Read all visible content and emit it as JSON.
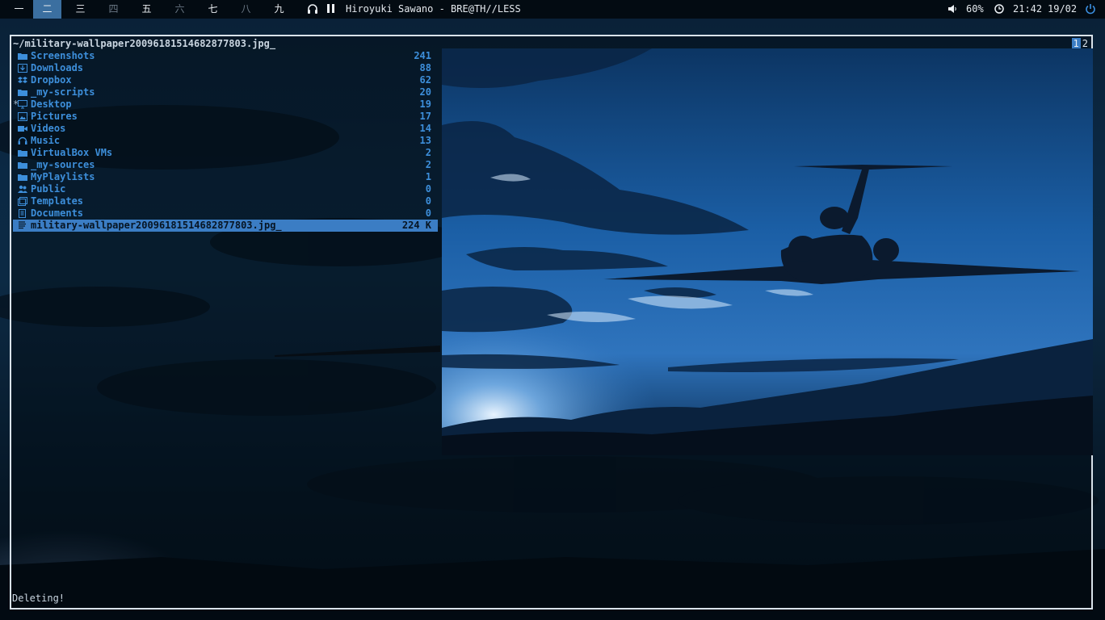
{
  "topbar": {
    "workspaces": [
      {
        "label": "一",
        "state": "normal"
      },
      {
        "label": "二",
        "state": "active"
      },
      {
        "label": "三",
        "state": "normal"
      },
      {
        "label": "四",
        "state": "empty"
      },
      {
        "label": "五",
        "state": "normal"
      },
      {
        "label": "六",
        "state": "empty"
      },
      {
        "label": "七",
        "state": "normal"
      },
      {
        "label": "八",
        "state": "empty"
      },
      {
        "label": "九",
        "state": "normal"
      }
    ],
    "media_icon": "headphones-icon",
    "playback_icon": "pause-icon",
    "now_playing": "Hiroyuki Sawano - BRE@TH//LESS",
    "volume_icon": "speaker-icon",
    "volume": "60%",
    "clock_icon": "clock-icon",
    "time": "21:42",
    "date": "19/02",
    "power_icon": "power-icon",
    "accent_color": "#3b6fa0"
  },
  "terminal": {
    "path": "~/military-wallpaper20096181514682877803.jpg_",
    "tabs": [
      "1",
      "2"
    ],
    "active_tab": "1",
    "entries": [
      {
        "icon": "folder-icon",
        "name": "Screenshots",
        "count": "241"
      },
      {
        "icon": "download-icon",
        "name": "Downloads",
        "count": "88"
      },
      {
        "icon": "dropbox-icon",
        "name": "Dropbox",
        "count": "62"
      },
      {
        "icon": "folder-icon",
        "name": "_my-scripts",
        "count": "20"
      },
      {
        "icon": "desktop-icon",
        "name": "Desktop",
        "count": "19",
        "mark": "*"
      },
      {
        "icon": "picture-icon",
        "name": "Pictures",
        "count": "17"
      },
      {
        "icon": "video-icon",
        "name": "Videos",
        "count": "14"
      },
      {
        "icon": "headphones-icon",
        "name": "Music",
        "count": "13"
      },
      {
        "icon": "folder-icon",
        "name": "VirtualBox VMs",
        "count": "2"
      },
      {
        "icon": "folder-icon",
        "name": "_my-sources",
        "count": "2"
      },
      {
        "icon": "folder-icon",
        "name": "MyPlaylists",
        "count": "1"
      },
      {
        "icon": "users-icon",
        "name": "Public",
        "count": "0"
      },
      {
        "icon": "template-icon",
        "name": "Templates",
        "count": "0"
      },
      {
        "icon": "document-icon",
        "name": "Documents",
        "count": "0"
      },
      {
        "icon": "file-icon",
        "name": "military-wallpaper20096181514682877803.jpg_",
        "count": "224 K",
        "selected": true
      }
    ],
    "status": "Deleting!",
    "colors": {
      "directory": "#3d8fdb",
      "selection": "#3b7dc4",
      "text": "#c9d5e0",
      "border": "#d9e2ea"
    }
  },
  "preview": {
    "subject": "airplane-silhouette-image"
  }
}
